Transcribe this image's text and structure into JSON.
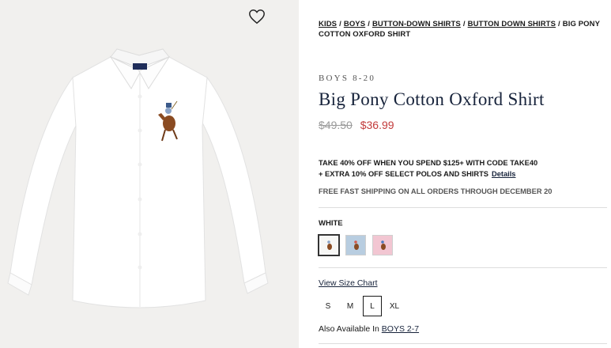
{
  "breadcrumb": [
    {
      "label": "KIDS"
    },
    {
      "label": "BOYS"
    },
    {
      "label": "BUTTON-DOWN SHIRTS"
    },
    {
      "label": "BUTTON DOWN SHIRTS"
    }
  ],
  "breadcrumb_current": "BIG PONY COTTON OXFORD SHIRT",
  "breadcrumb_separator": "/",
  "product": {
    "category": "BOYS 8-20",
    "title": "Big Pony Cotton Oxford Shirt",
    "original_price": "$49.50",
    "sale_price": "$36.99"
  },
  "promo": {
    "line1": "TAKE 40% OFF WHEN YOU SPEND $125+ WITH CODE TAKE40",
    "line2": "+ EXTRA 10% OFF SELECT POLOS AND SHIRTS",
    "details_link": "Details",
    "shipping": "FREE FAST SHIPPING ON ALL ORDERS THROUGH DECEMBER 20"
  },
  "color": {
    "selected_label": "WHITE",
    "swatches": [
      {
        "name": "white",
        "hex": "#f7f7f5",
        "selected": true
      },
      {
        "name": "blue",
        "hex": "#b8cde0",
        "selected": false
      },
      {
        "name": "pink",
        "hex": "#f2c6d2",
        "selected": false
      }
    ]
  },
  "size": {
    "chart_link": "View Size Chart",
    "options": [
      "S",
      "M",
      "L",
      "XL"
    ],
    "selected": "L"
  },
  "also_available": {
    "prefix": "Also Available In",
    "link": "BOYS 2-7"
  },
  "icons": {
    "wishlist": "heart-outline-icon"
  },
  "colors": {
    "navy": "#17233b",
    "sale": "#c23b3b",
    "image_bg": "#f1f0ee"
  }
}
